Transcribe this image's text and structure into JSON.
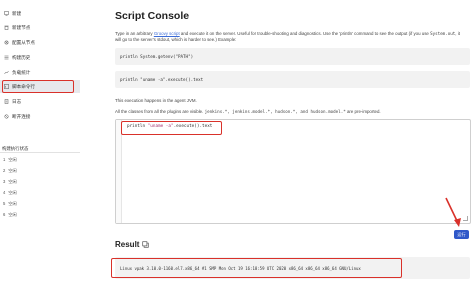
{
  "sidebar": {
    "items": [
      {
        "label": "新建",
        "icon": "plus-icon"
      },
      {
        "label": "新建节点",
        "icon": "computer-icon"
      },
      {
        "label": "配置从节点",
        "icon": "gear-icon"
      },
      {
        "label": "构建历史",
        "icon": "list-icon"
      },
      {
        "label": "负载统计",
        "icon": "chart-icon"
      },
      {
        "label": "脚本命令行",
        "icon": "terminal-icon"
      },
      {
        "label": "日志",
        "icon": "document-icon"
      },
      {
        "label": "断开连接",
        "icon": "disconnect-icon"
      }
    ],
    "queue_title": "构建执行状态",
    "queue": [
      {
        "index": "1",
        "label": "空闲"
      },
      {
        "index": "2",
        "label": "空闲"
      },
      {
        "index": "3",
        "label": "空闲"
      },
      {
        "index": "4",
        "label": "空闲"
      },
      {
        "index": "5",
        "label": "空闲"
      },
      {
        "index": "6",
        "label": "空闲"
      }
    ]
  },
  "main": {
    "title": "Script Console",
    "desc_part1": "Type in an arbitrary ",
    "desc_link": "Groovy script",
    "desc_part2": " and execute it on the server. Useful for trouble-shooting and diagnostics. Use the 'println' command to see the output (if you use ",
    "desc_code": "System.out",
    "desc_part3": ", it will go to the server's stdout, which is harder to see.) Example:",
    "example1": "println System.getenv(\"PATH\")",
    "example2": "println \"uname -a\".execute().text",
    "agent_note": "This execution happens in the agent JVM.",
    "imports_prefix": "All the classes from all the plugins are visible. ",
    "imports_code": "jenkins.*, jenkins.model.*, hudson.*, and hudson.model.*",
    "imports_suffix": " are pre-imported.",
    "editor_code_prefix": "println ",
    "editor_code_string": "\"uname -a\"",
    "editor_code_suffix": ".execute().text",
    "run_label": "运行",
    "result_title": "Result",
    "result_text": "Linux vpak 3.10.0-1160.el7.x86_64 #1 SMP Mon Oct 19 16:18:59 UTC 2020 x86_64 x86_64 x86_64 GNU/Linux"
  },
  "colors": {
    "accent": "#2f58c9",
    "highlight": "#d9312a",
    "active_bg": "#e7e8ec"
  }
}
